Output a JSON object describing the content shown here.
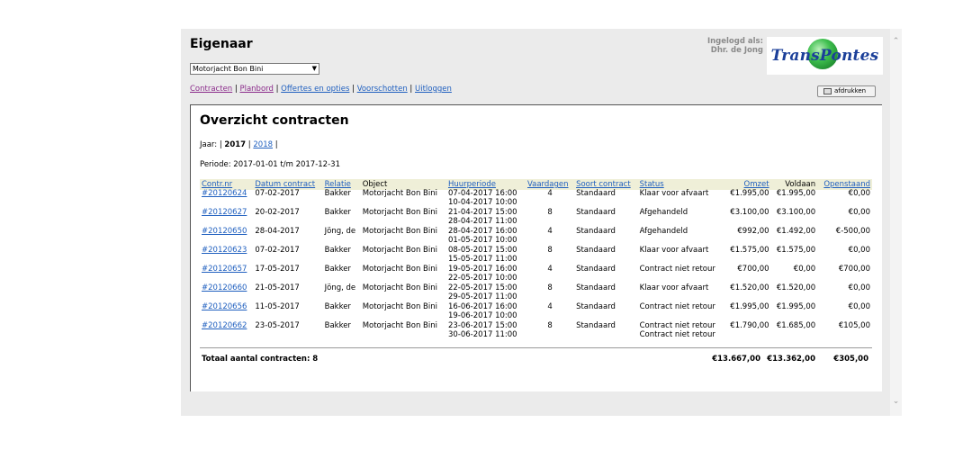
{
  "header": {
    "title": "Eigenaar",
    "object_select": "Motorjacht Bon Bini",
    "login_label": "Ingelogd als:",
    "login_user": "Dhr. de Jong",
    "logo_text": "TransPontes"
  },
  "nav": {
    "items": [
      "Contracten",
      "Planbord",
      "Offertes en opties",
      "Voorschotten",
      "Uitloggen"
    ],
    "separator": "|"
  },
  "toolbar": {
    "print_label": "afdrukken"
  },
  "overview": {
    "heading": "Overzicht contracten",
    "year_label": "Jaar:",
    "year_current": "2017",
    "year_other": "2018",
    "period_text": "Periode: 2017-01-01 t/m 2017-12-31"
  },
  "table": {
    "columns": [
      "Contr.nr",
      "Datum contract",
      "Relatie",
      "Object",
      "Huurperiode",
      "Vaardagen",
      "Soort contract",
      "Status",
      "Omzet",
      "Voldaan",
      "Openstaand"
    ],
    "rows": [
      {
        "nr": "#20120624",
        "datum": "07-02-2017",
        "relatie": "Bakker",
        "object": "Motorjacht Bon Bini",
        "periode1": "07-04-2017 16:00",
        "periode2": "10-04-2017 10:00",
        "vaardagen": "4",
        "soort": "Standaard",
        "status1": "Klaar voor afvaart",
        "status2": "",
        "omzet": "€1.995,00",
        "voldaan": "€1.995,00",
        "open": "€0,00"
      },
      {
        "nr": "#20120627",
        "datum": "20-02-2017",
        "relatie": "Bakker",
        "object": "Motorjacht Bon Bini",
        "periode1": "21-04-2017 15:00",
        "periode2": "28-04-2017 11:00",
        "vaardagen": "8",
        "soort": "Standaard",
        "status1": "Afgehandeld",
        "status2": "",
        "omzet": "€3.100,00",
        "voldaan": "€3.100,00",
        "open": "€0,00"
      },
      {
        "nr": "#20120650",
        "datum": "28-04-2017",
        "relatie": "Jöng, de",
        "object": "Motorjacht Bon Bini",
        "periode1": "28-04-2017 16:00",
        "periode2": "01-05-2017 10:00",
        "vaardagen": "4",
        "soort": "Standaard",
        "status1": "Afgehandeld",
        "status2": "",
        "omzet": "€992,00",
        "voldaan": "€1.492,00",
        "open": "€-500,00"
      },
      {
        "nr": "#20120623",
        "datum": "07-02-2017",
        "relatie": "Bakker",
        "object": "Motorjacht Bon Bini",
        "periode1": "08-05-2017 15:00",
        "periode2": "15-05-2017 11:00",
        "vaardagen": "8",
        "soort": "Standaard",
        "status1": "Klaar voor afvaart",
        "status2": "",
        "omzet": "€1.575,00",
        "voldaan": "€1.575,00",
        "open": "€0,00"
      },
      {
        "nr": "#20120657",
        "datum": "17-05-2017",
        "relatie": "Bakker",
        "object": "Motorjacht Bon Bini",
        "periode1": "19-05-2017 16:00",
        "periode2": "22-05-2017 10:00",
        "vaardagen": "4",
        "soort": "Standaard",
        "status1": "Contract niet retour",
        "status2": "",
        "omzet": "€700,00",
        "voldaan": "€0,00",
        "open": "€700,00"
      },
      {
        "nr": "#20120660",
        "datum": "21-05-2017",
        "relatie": "Jöng, de",
        "object": "Motorjacht Bon Bini",
        "periode1": "22-05-2017 15:00",
        "periode2": "29-05-2017 11:00",
        "vaardagen": "8",
        "soort": "Standaard",
        "status1": "Klaar voor afvaart",
        "status2": "",
        "omzet": "€1.520,00",
        "voldaan": "€1.520,00",
        "open": "€0,00"
      },
      {
        "nr": "#20120656",
        "datum": "11-05-2017",
        "relatie": "Bakker",
        "object": "Motorjacht Bon Bini",
        "periode1": "16-06-2017 16:00",
        "periode2": "19-06-2017 10:00",
        "vaardagen": "4",
        "soort": "Standaard",
        "status1": "Contract niet retour",
        "status2": "",
        "omzet": "€1.995,00",
        "voldaan": "€1.995,00",
        "open": "€0,00"
      },
      {
        "nr": "#20120662",
        "datum": "23-05-2017",
        "relatie": "Bakker",
        "object": "Motorjacht Bon Bini",
        "periode1": "23-06-2017 15:00",
        "periode2": "30-06-2017 11:00",
        "vaardagen": "8",
        "soort": "Standaard",
        "status1": "Contract niet retour",
        "status2": "Contract niet retour",
        "omzet": "€1.790,00",
        "voldaan": "€1.685,00",
        "open": "€105,00"
      }
    ],
    "totals": {
      "label": "Totaal aantal contracten: 8",
      "omzet": "€13.667,00",
      "voldaan": "€13.362,00",
      "open": "€305,00"
    }
  },
  "colors": {
    "link": "#1f5fbf",
    "visited_link": "#8a2a8a",
    "header_row": "#efefd8",
    "page_bg": "#ebebeb"
  }
}
